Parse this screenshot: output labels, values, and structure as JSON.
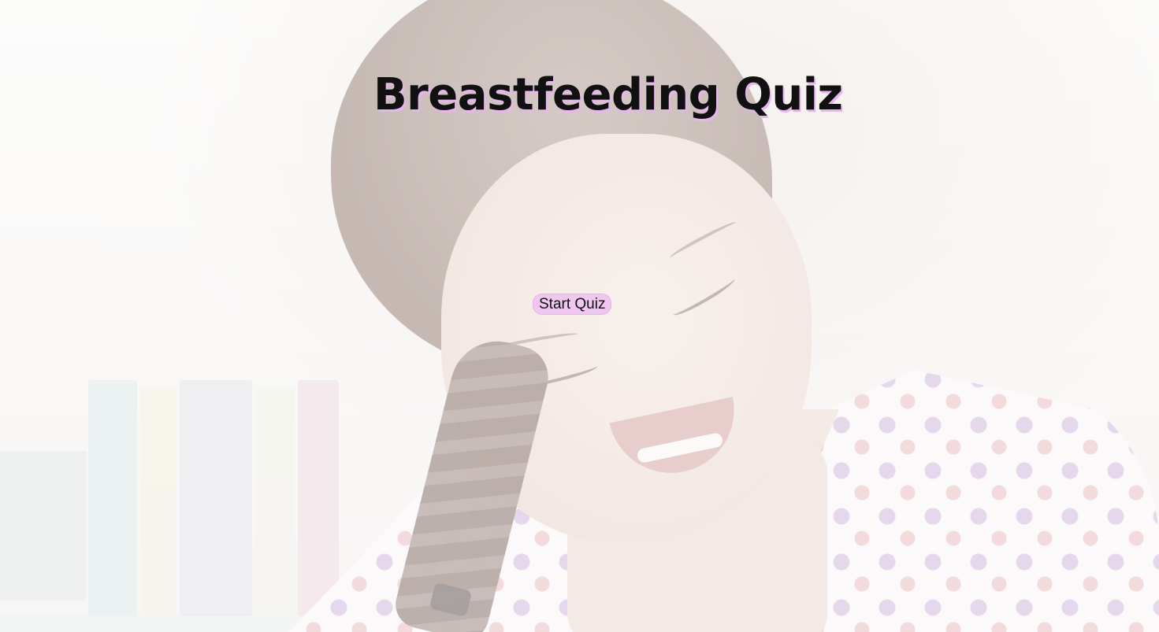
{
  "page": {
    "title": "Breastfeeding Quiz"
  },
  "actions": {
    "start_label": "Start Quiz"
  },
  "theme": {
    "accent": "#efc7f0",
    "title_shadow": "#e8b6ee",
    "text": "#111111"
  },
  "background": {
    "icon": "hero-photo"
  }
}
